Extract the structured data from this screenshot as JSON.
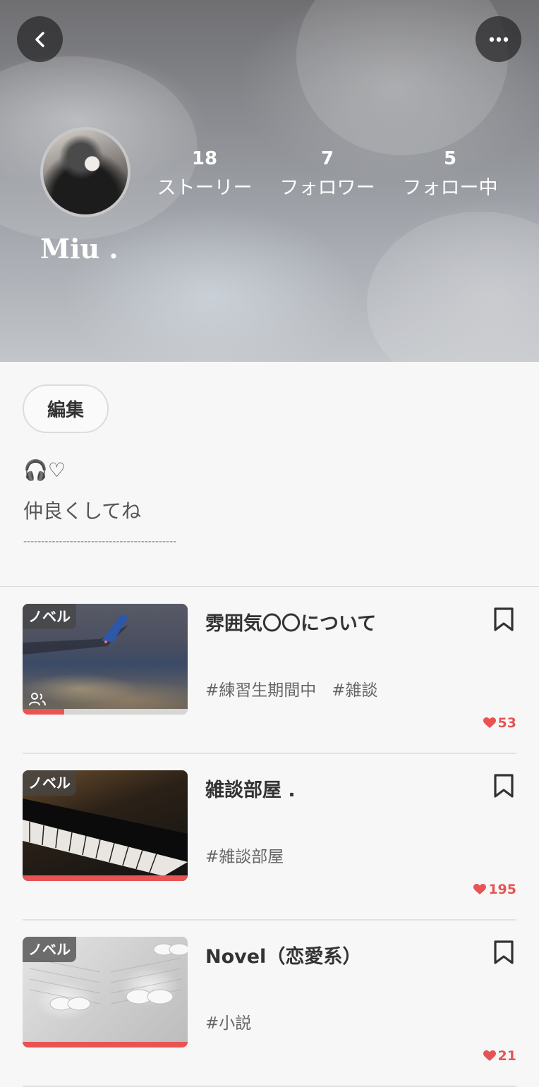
{
  "profile": {
    "name": "Miu .",
    "stats": [
      {
        "value": "18",
        "label": "ストーリー"
      },
      {
        "value": "7",
        "label": "フォロワー"
      },
      {
        "value": "5",
        "label": "フォロー中"
      }
    ],
    "edit_label": "編集",
    "bio_line1": "🎧♡",
    "bio_line2": "仲良くしてね",
    "bio_line3": "-------------------------------------------"
  },
  "stories": [
    {
      "badge": "ノベル",
      "title": "雰囲気〇〇について",
      "tags": [
        "#練習生期間中",
        "#雑談"
      ],
      "likes": "53",
      "progress": 0.25,
      "group_icon": "people-icon"
    },
    {
      "badge": "ノベル",
      "title": "雑談部屋 .",
      "tags": [
        "#雑談部屋"
      ],
      "likes": "195",
      "progress": 1.0
    },
    {
      "badge": "ノベル",
      "title": "Novel（恋愛系）",
      "tags": [
        "#小説"
      ],
      "likes": "21",
      "progress": 1.0
    }
  ],
  "colors": {
    "accent": "#e85454",
    "text": "#333333",
    "background": "#f7f7f7"
  },
  "icons": {
    "back": "chevron-left-icon",
    "more": "more-horizontal-icon",
    "bookmark": "bookmark-icon",
    "heart": "heart-icon"
  }
}
